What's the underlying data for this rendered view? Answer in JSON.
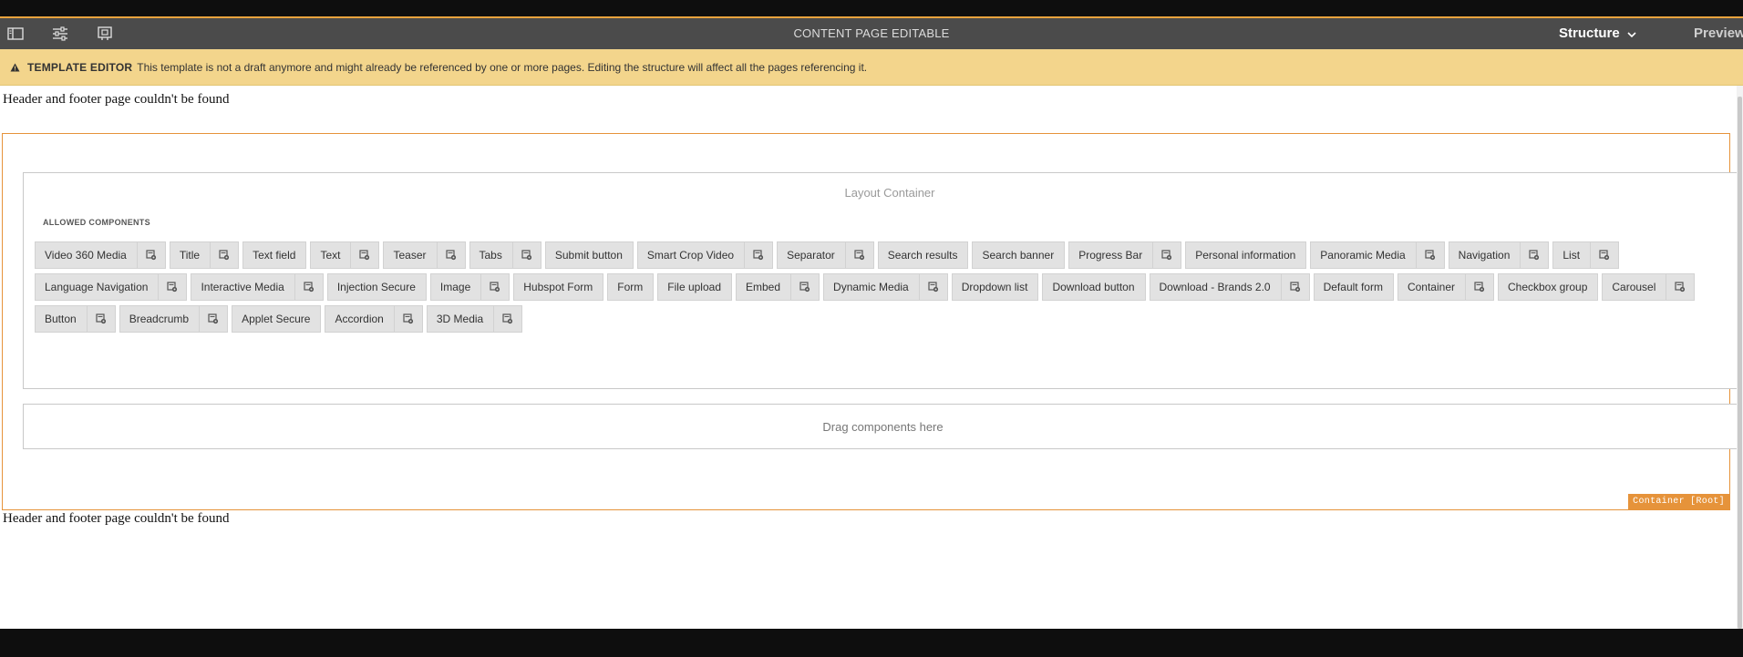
{
  "toolbar": {
    "title": "CONTENT PAGE EDITABLE",
    "mode_label": "Structure",
    "preview_label": "Preview",
    "icons": [
      "side-panel-icon",
      "properties-icon",
      "page-settings-icon",
      "chevron-down-icon"
    ]
  },
  "alert": {
    "tag": "TEMPLATE EDITOR",
    "message": "This template is not a draft anymore and might already be referenced by one or more pages. Editing the structure will affect all the pages referencing it."
  },
  "page": {
    "header_note": "Header and footer page couldn't be found",
    "footer_note": "Header and footer page couldn't be found",
    "root_container_label": "Container [Root]",
    "layout_container_title": "Layout Container",
    "allowed_label": "ALLOWED COMPONENTS",
    "dropzone_label": "Drag components here"
  },
  "components": [
    {
      "label": "Video 360 Media",
      "policy": true
    },
    {
      "label": "Title",
      "policy": true
    },
    {
      "label": "Text field",
      "policy": false
    },
    {
      "label": "Text",
      "policy": true
    },
    {
      "label": "Teaser",
      "policy": true
    },
    {
      "label": "Tabs",
      "policy": true
    },
    {
      "label": "Submit button",
      "policy": false
    },
    {
      "label": "Smart Crop Video",
      "policy": true
    },
    {
      "label": "Separator",
      "policy": true
    },
    {
      "label": "Search results",
      "policy": false
    },
    {
      "label": "Search banner",
      "policy": false
    },
    {
      "label": "Progress Bar",
      "policy": true
    },
    {
      "label": "Personal information",
      "policy": false
    },
    {
      "label": "Panoramic Media",
      "policy": true
    },
    {
      "label": "Navigation",
      "policy": true
    },
    {
      "label": "List",
      "policy": true
    },
    {
      "label": "Language Navigation",
      "policy": true
    },
    {
      "label": "Interactive Media",
      "policy": true
    },
    {
      "label": "Injection Secure",
      "policy": false
    },
    {
      "label": "Image",
      "policy": true
    },
    {
      "label": "Hubspot Form",
      "policy": false
    },
    {
      "label": "Form",
      "policy": false
    },
    {
      "label": "File upload",
      "policy": false
    },
    {
      "label": "Embed",
      "policy": true
    },
    {
      "label": "Dynamic Media",
      "policy": true
    },
    {
      "label": "Dropdown list",
      "policy": false
    },
    {
      "label": "Download button",
      "policy": false
    },
    {
      "label": "Download - Brands 2.0",
      "policy": true
    },
    {
      "label": "Default form",
      "policy": false
    },
    {
      "label": "Container",
      "policy": true
    },
    {
      "label": "Checkbox group",
      "policy": false
    },
    {
      "label": "Carousel",
      "policy": true
    },
    {
      "label": "Button",
      "policy": true
    },
    {
      "label": "Breadcrumb",
      "policy": true
    },
    {
      "label": "Applet Secure",
      "policy": false
    },
    {
      "label": "Accordion",
      "policy": true
    },
    {
      "label": "3D Media",
      "policy": true
    }
  ],
  "colors": {
    "toolbar_bg": "#4b4b4b",
    "alert_bg": "#f3d58c",
    "accent_orange": "#e6933a",
    "chip_bg": "#e2e2e2"
  }
}
